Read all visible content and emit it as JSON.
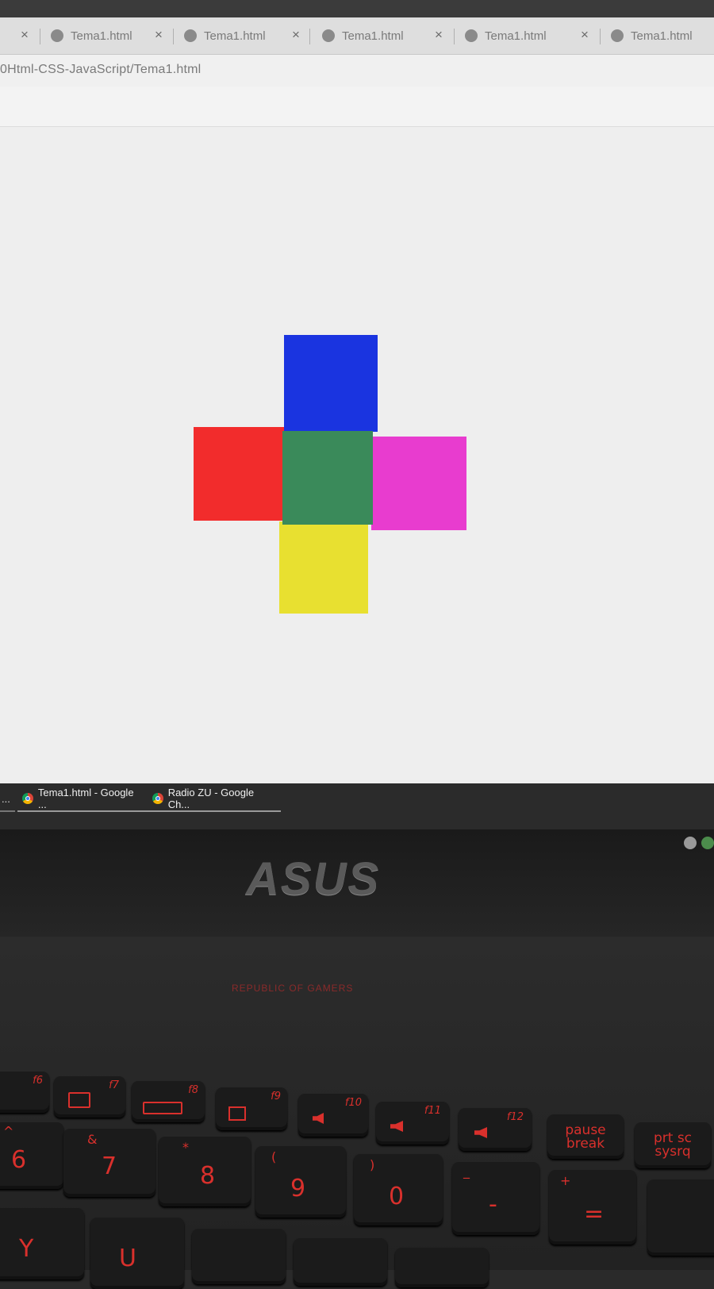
{
  "browser": {
    "tabs": [
      {
        "label": "Tema1.html"
      },
      {
        "label": "Tema1.html"
      },
      {
        "label": "Tema1.html"
      },
      {
        "label": "Tema1.html"
      },
      {
        "label": "Tema1.html"
      }
    ],
    "close_glyph": "×",
    "url": "0Html-CSS-JavaScript/Tema1.html"
  },
  "page": {
    "squares": [
      {
        "name": "top",
        "color": "#1a34e0"
      },
      {
        "name": "left",
        "color": "#f22c2c"
      },
      {
        "name": "center",
        "color": "#3a8a5a"
      },
      {
        "name": "right",
        "color": "#e83ccf"
      },
      {
        "name": "bottom",
        "color": "#e8e030"
      }
    ]
  },
  "taskbar": {
    "items": [
      {
        "label": "Tema1.html - Google ..."
      },
      {
        "label": "Radio ZU - Google Ch..."
      }
    ],
    "overflow_label": "..."
  },
  "laptop": {
    "brand": "ASUS",
    "rog_text": "REPUBLIC OF GAMERS"
  },
  "keyboard": {
    "fkeys": [
      {
        "fn": "f6"
      },
      {
        "fn": "f7"
      },
      {
        "fn": "f8"
      },
      {
        "fn": "f9"
      },
      {
        "fn": "f10"
      },
      {
        "fn": "f11"
      },
      {
        "fn": "f12"
      }
    ],
    "pause_break": "pause break",
    "prt_sc": "prt sc sysrq",
    "numbers": [
      {
        "main": "6",
        "shift": "^"
      },
      {
        "main": "7",
        "shift": "&"
      },
      {
        "main": "8",
        "shift": "*"
      },
      {
        "main": "9",
        "shift": "("
      },
      {
        "main": "0",
        "shift": ")"
      },
      {
        "main": "-",
        "shift": "_"
      },
      {
        "main": "=",
        "shift": "+"
      }
    ],
    "letters": [
      {
        "main": "Y"
      },
      {
        "main": "U"
      }
    ]
  }
}
